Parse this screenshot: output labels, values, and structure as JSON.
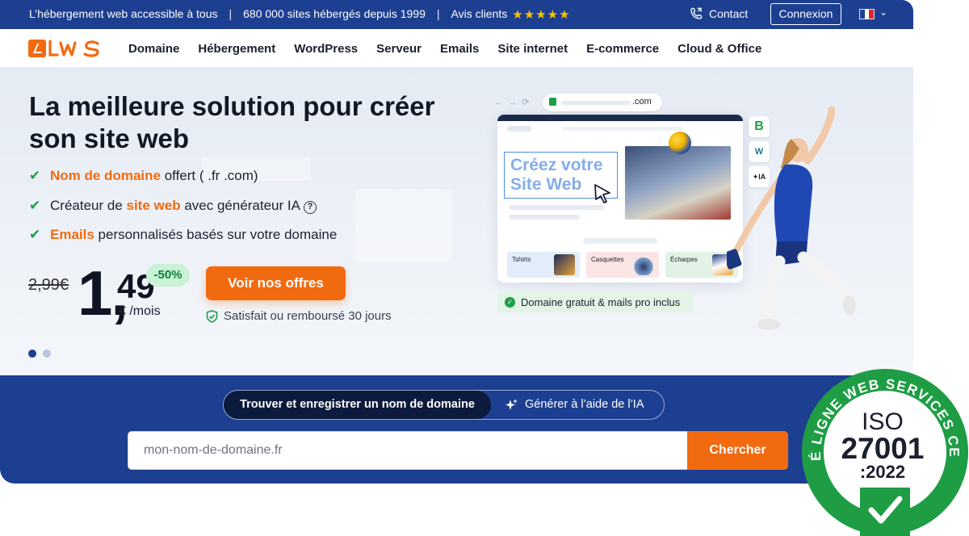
{
  "topbar": {
    "tagline": "L’hébergement web accessible à tous",
    "sep": "|",
    "sites": "680 000 sites hébergés depuis 1999",
    "reviews": "Avis clients",
    "stars": "★★★★★",
    "contact": "Contact",
    "login": "Connexion"
  },
  "nav": {
    "items": [
      "Domaine",
      "Hébergement",
      "WordPress",
      "Serveur",
      "Emails",
      "Site internet",
      "E-commerce",
      "Cloud & Office"
    ]
  },
  "hero": {
    "title": "La meilleure solution pour créer son site web",
    "features": [
      {
        "highlight": "Nom de domaine",
        "rest": " offert ( .fr .com)"
      },
      {
        "before": "Créateur de ",
        "highlight": "site web",
        "rest": " avec générateur IA"
      },
      {
        "highlight": "Emails",
        "rest": " personnalisés basés sur votre domaine"
      }
    ],
    "help": "?",
    "old_price": "2,99€",
    "price_int": "1,",
    "price_dec": "49",
    "price_unit": "€ /mois",
    "discount": "-50%",
    "cta": "Voir nos offres",
    "guarantee": "Satisfait ou remboursé 30 jours",
    "slides_total": 2,
    "slide_active": 1
  },
  "mockup": {
    "url": ".com",
    "headline_1": "Créez votre",
    "headline_2": "Site Web",
    "products": [
      "Tshirts",
      "Casquettes",
      "Écharpes"
    ],
    "side_icons": [
      "B",
      "W",
      "✦IA"
    ],
    "badge": "Domaine gratuit & mails pro inclus"
  },
  "search": {
    "tab_active": "Trouver et enregistrer un nom de domaine",
    "tab_ai": "Générer à l’aide de l’IA",
    "placeholder": "mon-nom-de-domaine.fr",
    "button": "Chercher"
  },
  "iso_badge": {
    "ring_text": "SOCIÉTÉ LIGNE WEB SERVICES CERTIFIÉE",
    "iso": "ISO",
    "number": "27001",
    "year": ":2022"
  },
  "colors": {
    "brand_blue": "#1d3f91",
    "accent_orange": "#f26a10",
    "success_green": "#1f9d45"
  }
}
